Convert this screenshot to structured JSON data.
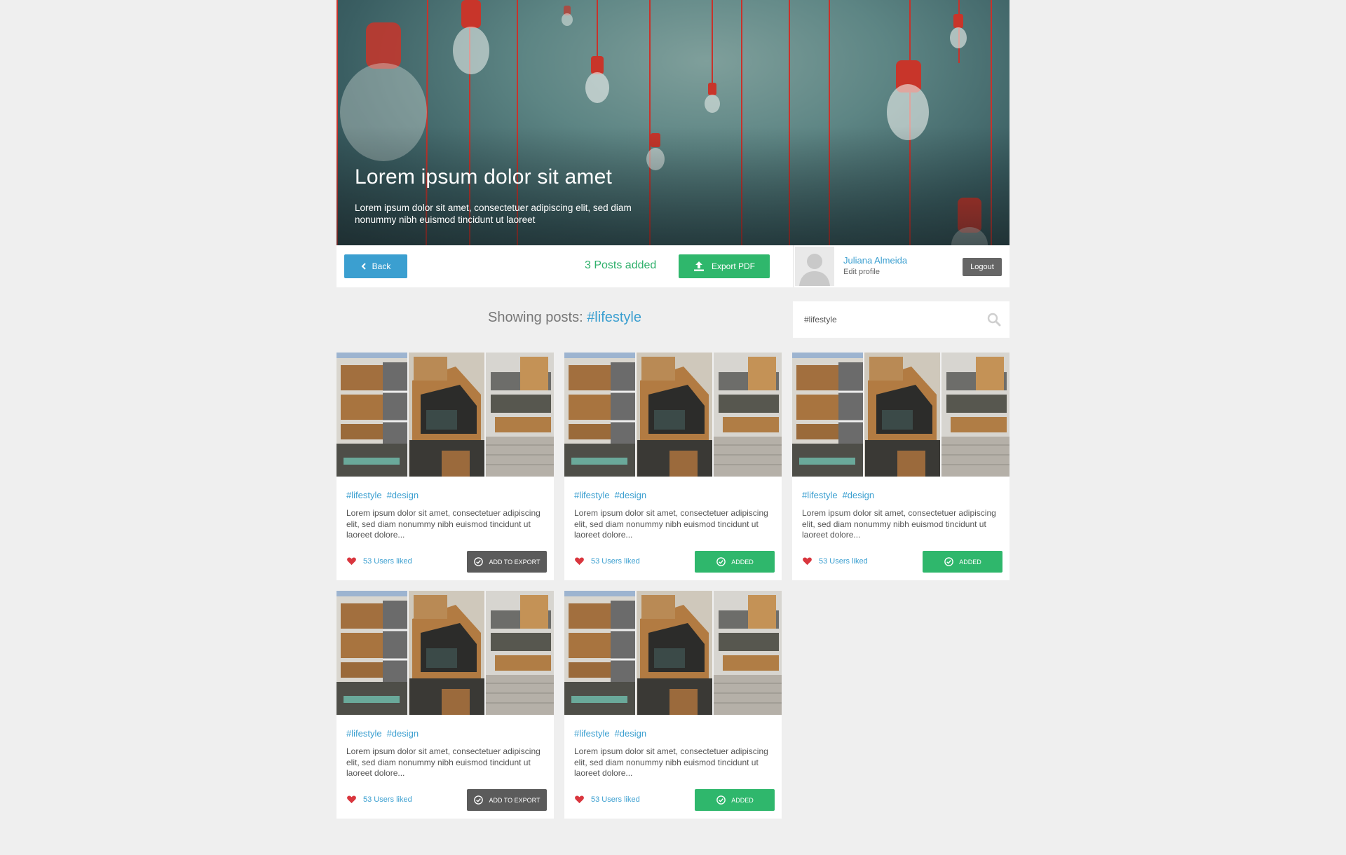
{
  "hero": {
    "title": "Lorem ipsum dolor sit amet",
    "subtitle": "Lorem ipsum dolor sit amet, consectetuer adipiscing elit, sed diam nonummy nibh euismod tincidunt ut laoreet"
  },
  "toolbar": {
    "back_label": "Back",
    "posts_added": "3 Posts added",
    "export_label": "Export PDF"
  },
  "profile": {
    "name": "Juliana Almeida",
    "edit_label": "Edit profile",
    "logout_label": "Logout"
  },
  "filter": {
    "prefix": "Showing posts:",
    "tag": "#lifestyle"
  },
  "search": {
    "value": "#lifestyle"
  },
  "posts": [
    {
      "tag1": "#lifestyle",
      "tag2": "#design",
      "text": "Lorem ipsum dolor sit amet, consectetuer adipiscing elit, sed diam nonummy nibh euismod tincidunt ut laoreet dolore...",
      "likes": "53 Users liked",
      "action": "ADD TO EXPORT",
      "state": "add"
    },
    {
      "tag1": "#lifestyle",
      "tag2": "#design",
      "text": "Lorem ipsum dolor sit amet, consectetuer adipiscing elit, sed diam nonummy nibh euismod tincidunt ut laoreet dolore...",
      "likes": "53 Users liked",
      "action": "ADDED",
      "state": "added"
    },
    {
      "tag1": "#lifestyle",
      "tag2": "#design",
      "text": "Lorem ipsum dolor sit amet, consectetuer adipiscing elit, sed diam nonummy nibh euismod tincidunt ut laoreet dolore...",
      "likes": "53 Users liked",
      "action": "ADDED",
      "state": "added"
    },
    {
      "tag1": "#lifestyle",
      "tag2": "#design",
      "text": "Lorem ipsum dolor sit amet, consectetuer adipiscing elit, sed diam nonummy nibh euismod tincidunt ut laoreet dolore...",
      "likes": "53 Users liked",
      "action": "ADD TO EXPORT",
      "state": "add"
    },
    {
      "tag1": "#lifestyle",
      "tag2": "#design",
      "text": "Lorem ipsum dolor sit amet, consectetuer adipiscing elit, sed diam nonummy nibh euismod tincidunt ut laoreet dolore...",
      "likes": "53 Users liked",
      "action": "ADDED",
      "state": "added"
    }
  ],
  "colors": {
    "accent_blue": "#3b9fd0",
    "accent_green": "#2fb76c",
    "button_dark": "#5b5b5b",
    "heart": "#d9363e",
    "page_bg": "#efefef"
  },
  "icons": {
    "back": "chevron-left-icon",
    "export": "upload-icon",
    "search": "search-icon",
    "like": "heart-icon",
    "action": "check-circle-icon"
  }
}
